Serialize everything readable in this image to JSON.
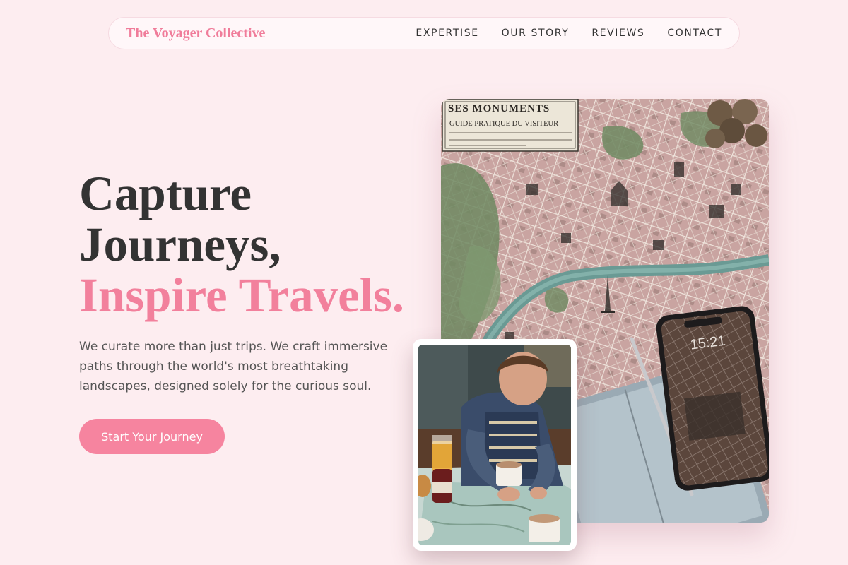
{
  "nav": {
    "brand": "The Voyager Collective",
    "links": [
      "EXPERTISE",
      "OUR STORY",
      "REVIEWS",
      "CONTACT"
    ]
  },
  "hero": {
    "title_line1": "Capture",
    "title_line2": "Journeys,",
    "title_accent": "Inspire Travels.",
    "description": "We curate more than just trips. We craft immersive paths through the world's most breathtaking landscapes, designed solely for the curious soul.",
    "cta_label": "Start Your Journey"
  },
  "images": {
    "main": {
      "map_header": "SES MONUMENTS",
      "map_subheader": "GUIDE PRATIQUE DU VISITEUR",
      "phone_time": "15:21"
    },
    "inset": {}
  },
  "colors": {
    "background": "#fdedf0",
    "accent": "#f2809c",
    "button": "#f6849f",
    "text": "#333333"
  }
}
